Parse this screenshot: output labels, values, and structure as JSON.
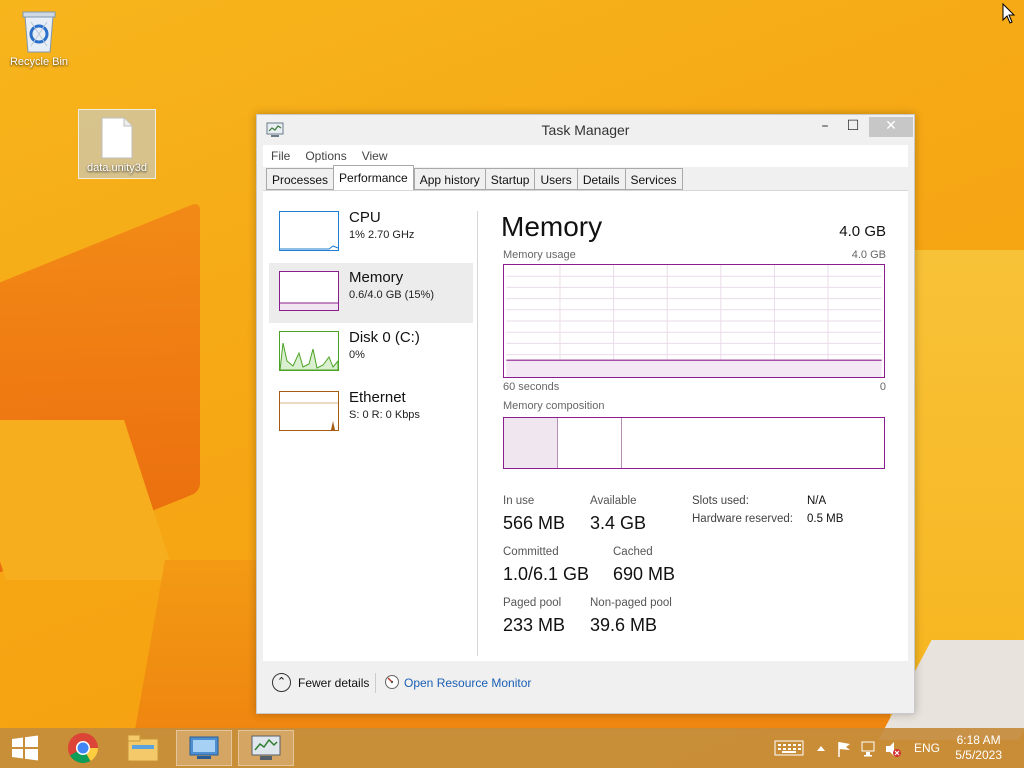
{
  "desktop": {
    "icons": [
      {
        "label": "Recycle Bin",
        "icon": "recycle-bin-icon"
      },
      {
        "label": "data.unity3d",
        "icon": "file-icon"
      }
    ]
  },
  "window": {
    "title": "Task Manager",
    "minimize_glyph": "–",
    "maximize_glyph": "☐",
    "close_glyph": "✕",
    "menu": [
      "File",
      "Options",
      "View"
    ],
    "tabs": [
      "Processes",
      "Performance",
      "App history",
      "Startup",
      "Users",
      "Details",
      "Services"
    ],
    "active_tab": "Performance"
  },
  "sidebar": {
    "items": [
      {
        "name": "CPU",
        "sub": "1%  2.70 GHz",
        "color": "#1f7ccf"
      },
      {
        "name": "Memory",
        "sub": "0.6/4.0 GB (15%)",
        "color": "#8b1e8e"
      },
      {
        "name": "Disk 0 (C:)",
        "sub": "0%",
        "color": "#4da325"
      },
      {
        "name": "Ethernet",
        "sub": "S: 0 R: 0 Kbps",
        "color": "#a75b12"
      }
    ]
  },
  "detail": {
    "heading": "Memory",
    "total": "4.0 GB",
    "usage_label": "Memory usage",
    "usage_max": "4.0 GB",
    "graph_left": "60 seconds",
    "graph_right": "0",
    "usage_fraction": 0.15,
    "composition_label": "Memory composition",
    "stats": [
      {
        "label": "In use",
        "value": "566 MB"
      },
      {
        "label": "Available",
        "value": "3.4 GB"
      },
      {
        "label": "Committed",
        "value": "1.0/6.1 GB"
      },
      {
        "label": "Cached",
        "value": "690 MB"
      },
      {
        "label": "Paged pool",
        "value": "233 MB"
      },
      {
        "label": "Non-paged pool",
        "value": "39.6 MB"
      }
    ],
    "kv": [
      {
        "label": "Slots used:",
        "value": "N/A"
      },
      {
        "label": "Hardware reserved:",
        "value": "0.5 MB"
      }
    ],
    "accent_color": "#8b1e8e"
  },
  "footer": {
    "fewer_details": "Fewer details",
    "open_resource_monitor": "Open Resource Monitor"
  },
  "taskbar": {
    "apps": [
      "start-button",
      "chrome-icon",
      "file-explorer-icon",
      "remote-desktop-icon",
      "task-manager-icon"
    ],
    "language": "ENG",
    "time": "6:18 AM",
    "date": "5/5/2023"
  }
}
